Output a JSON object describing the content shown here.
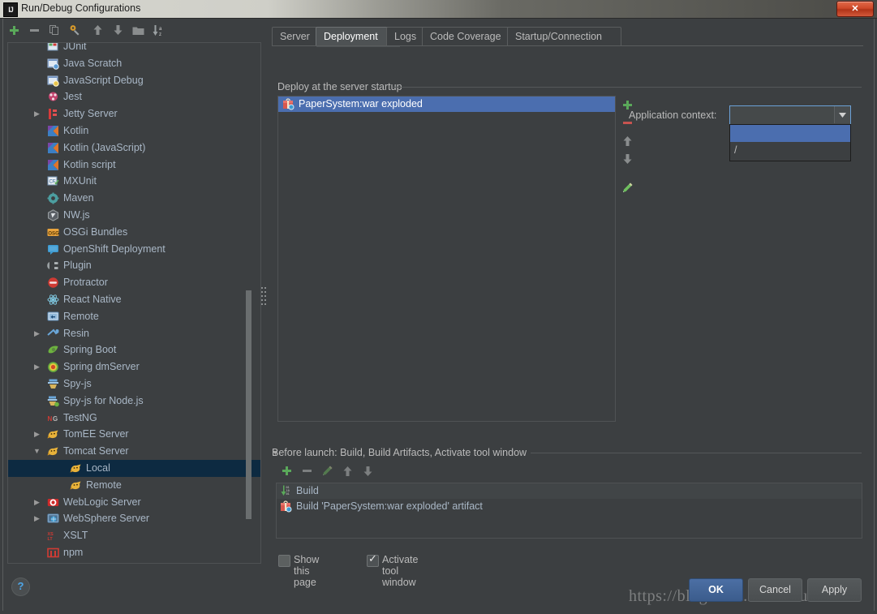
{
  "window": {
    "title": "Run/Debug Configurations",
    "app_icon": "intellij-idea-icon",
    "close_label": "✕"
  },
  "left_toolbar": {
    "buttons": [
      {
        "name": "add-configuration-button",
        "icon": "plus-icon",
        "title": "Add New Configuration"
      },
      {
        "name": "remove-configuration-button",
        "icon": "minus-icon",
        "title": "Remove Configuration"
      },
      {
        "name": "copy-configuration-button",
        "icon": "copy-icon",
        "title": "Copy Configuration"
      },
      {
        "name": "edit-defaults-button",
        "icon": "wrench-icon",
        "title": "Edit defaults"
      },
      {
        "name": "move-up-button",
        "icon": "arrow-up-icon",
        "title": "Move Up"
      },
      {
        "name": "move-down-button",
        "icon": "arrow-down-icon",
        "title": "Move Down"
      },
      {
        "name": "create-folder-button",
        "icon": "folder-icon",
        "title": "Create New Folder"
      },
      {
        "name": "sort-configurations-button",
        "icon": "sort-az-icon",
        "title": "Sort Configurations"
      }
    ]
  },
  "sidebar": {
    "items": [
      {
        "label": "JUnit",
        "icon": "junit-icon",
        "level": 1,
        "expandable": false,
        "selected": false,
        "partial": true
      },
      {
        "label": "Java Scratch",
        "icon": "java-scratch-icon",
        "level": 1,
        "expandable": false,
        "selected": false
      },
      {
        "label": "JavaScript Debug",
        "icon": "javascript-debug-icon",
        "level": 1,
        "expandable": false,
        "selected": false
      },
      {
        "label": "Jest",
        "icon": "jest-icon",
        "level": 1,
        "expandable": false,
        "selected": false
      },
      {
        "label": "Jetty Server",
        "icon": "jetty-icon",
        "level": 1,
        "expandable": true,
        "expanded": false,
        "selected": false
      },
      {
        "label": "Kotlin",
        "icon": "kotlin-icon",
        "level": 1,
        "expandable": false,
        "selected": false
      },
      {
        "label": "Kotlin (JavaScript)",
        "icon": "kotlin-icon",
        "level": 1,
        "expandable": false,
        "selected": false
      },
      {
        "label": "Kotlin script",
        "icon": "kotlin-icon",
        "level": 1,
        "expandable": false,
        "selected": false
      },
      {
        "label": "MXUnit",
        "icon": "mxunit-icon",
        "level": 1,
        "expandable": false,
        "selected": false
      },
      {
        "label": "Maven",
        "icon": "maven-icon",
        "level": 1,
        "expandable": false,
        "selected": false
      },
      {
        "label": "NW.js",
        "icon": "nwjs-icon",
        "level": 1,
        "expandable": false,
        "selected": false
      },
      {
        "label": "OSGi Bundles",
        "icon": "osgi-icon",
        "level": 1,
        "expandable": false,
        "selected": false
      },
      {
        "label": "OpenShift Deployment",
        "icon": "openshift-icon",
        "level": 1,
        "expandable": false,
        "selected": false
      },
      {
        "label": "Plugin",
        "icon": "plugin-icon",
        "level": 1,
        "expandable": false,
        "selected": false
      },
      {
        "label": "Protractor",
        "icon": "protractor-icon",
        "level": 1,
        "expandable": false,
        "selected": false
      },
      {
        "label": "React Native",
        "icon": "react-native-icon",
        "level": 1,
        "expandable": false,
        "selected": false
      },
      {
        "label": "Remote",
        "icon": "remote-icon",
        "level": 1,
        "expandable": false,
        "selected": false
      },
      {
        "label": "Resin",
        "icon": "resin-icon",
        "level": 1,
        "expandable": true,
        "expanded": false,
        "selected": false
      },
      {
        "label": "Spring Boot",
        "icon": "spring-boot-icon",
        "level": 1,
        "expandable": false,
        "selected": false
      },
      {
        "label": "Spring dmServer",
        "icon": "spring-dmserver-icon",
        "level": 1,
        "expandable": true,
        "expanded": false,
        "selected": false
      },
      {
        "label": "Spy-js",
        "icon": "spyjs-icon",
        "level": 1,
        "expandable": false,
        "selected": false
      },
      {
        "label": "Spy-js for Node.js",
        "icon": "spyjs-node-icon",
        "level": 1,
        "expandable": false,
        "selected": false
      },
      {
        "label": "TestNG",
        "icon": "testng-icon",
        "level": 1,
        "expandable": false,
        "selected": false
      },
      {
        "label": "TomEE Server",
        "icon": "tomcat-icon",
        "level": 1,
        "expandable": true,
        "expanded": false,
        "selected": false
      },
      {
        "label": "Tomcat Server",
        "icon": "tomcat-icon",
        "level": 1,
        "expandable": true,
        "expanded": true,
        "selected": false
      },
      {
        "label": "Local",
        "icon": "tomcat-icon",
        "level": 2,
        "expandable": false,
        "selected": true
      },
      {
        "label": "Remote",
        "icon": "tomcat-icon",
        "level": 2,
        "expandable": false,
        "selected": false
      },
      {
        "label": "WebLogic Server",
        "icon": "weblogic-icon",
        "level": 1,
        "expandable": true,
        "expanded": false,
        "selected": false
      },
      {
        "label": "WebSphere Server",
        "icon": "websphere-icon",
        "level": 1,
        "expandable": true,
        "expanded": false,
        "selected": false
      },
      {
        "label": "XSLT",
        "icon": "xslt-icon",
        "level": 1,
        "expandable": false,
        "selected": false
      },
      {
        "label": "npm",
        "icon": "npm-icon",
        "level": 1,
        "expandable": false,
        "selected": false
      }
    ]
  },
  "tabs": [
    {
      "label": "Server",
      "active": false
    },
    {
      "label": "Deployment",
      "active": true
    },
    {
      "label": "Logs",
      "active": false
    },
    {
      "label": "Code Coverage",
      "active": false
    },
    {
      "label": "Startup/Connection",
      "active": false
    }
  ],
  "deployment": {
    "group_label": "Deploy at the server startup",
    "artifacts": [
      {
        "label": "PaperSystem:war exploded",
        "icon": "artifact-icon",
        "selected": true
      }
    ],
    "tools": [
      {
        "name": "add-artifact-button",
        "icon": "plus-icon"
      },
      {
        "name": "remove-artifact-button",
        "icon": "minus-icon"
      },
      {
        "name": "move-artifact-up-button",
        "icon": "arrow-up-icon"
      },
      {
        "name": "move-artifact-down-button",
        "icon": "arrow-down-icon"
      },
      {
        "name": "edit-artifact-button",
        "icon": "pencil-icon"
      }
    ],
    "application_context": {
      "label": "Application context:",
      "value": "",
      "placeholder": "",
      "dropdown_open": true,
      "options": [
        {
          "label": "",
          "selected": true
        },
        {
          "label": "/",
          "selected": false
        }
      ]
    }
  },
  "before_launch": {
    "header": "Before launch: Build, Build Artifacts, Activate tool window",
    "tools": [
      {
        "name": "add-task-button",
        "icon": "plus-icon"
      },
      {
        "name": "remove-task-button",
        "icon": "minus-icon"
      },
      {
        "name": "edit-task-button",
        "icon": "pencil-icon"
      },
      {
        "name": "move-task-up-button",
        "icon": "arrow-up-icon"
      },
      {
        "name": "move-task-down-button",
        "icon": "arrow-down-icon"
      }
    ],
    "tasks": [
      {
        "label": "Build",
        "icon": "build-icon"
      },
      {
        "label": "Build 'PaperSystem:war exploded' artifact",
        "icon": "artifact-icon"
      }
    ],
    "checkboxes": [
      {
        "label": "Show this page",
        "checked": false
      },
      {
        "label": "Activate tool window",
        "checked": true
      }
    ]
  },
  "footer": {
    "help_label": "?",
    "buttons": [
      {
        "label": "OK",
        "primary": true
      },
      {
        "label": "Cancel",
        "primary": false
      },
      {
        "label": "Apply",
        "primary": false
      }
    ]
  },
  "watermark": "https://blog.csdn.net/knxu666",
  "colors": {
    "background": "#3c3f41",
    "selection_blue": "#4b6eaf",
    "tree_selection": "#0d2a41",
    "text": "#a9b7c6",
    "accent_green": "#63b863",
    "accent_red": "#c75450",
    "focus_border": "#6ba1d6"
  }
}
